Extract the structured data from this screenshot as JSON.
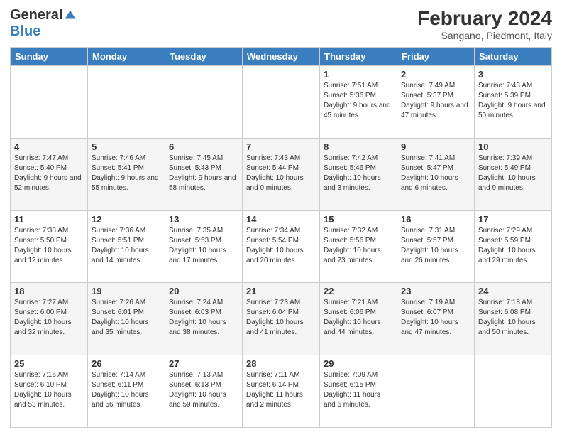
{
  "logo": {
    "general": "General",
    "blue": "Blue"
  },
  "header": {
    "month_year": "February 2024",
    "location": "Sangano, Piedmont, Italy"
  },
  "days_of_week": [
    "Sunday",
    "Monday",
    "Tuesday",
    "Wednesday",
    "Thursday",
    "Friday",
    "Saturday"
  ],
  "weeks": [
    [
      {
        "day": "",
        "info": ""
      },
      {
        "day": "",
        "info": ""
      },
      {
        "day": "",
        "info": ""
      },
      {
        "day": "",
        "info": ""
      },
      {
        "day": "1",
        "info": "Sunrise: 7:51 AM\nSunset: 5:36 PM\nDaylight: 9 hours\nand 45 minutes."
      },
      {
        "day": "2",
        "info": "Sunrise: 7:49 AM\nSunset: 5:37 PM\nDaylight: 9 hours\nand 47 minutes."
      },
      {
        "day": "3",
        "info": "Sunrise: 7:48 AM\nSunset: 5:39 PM\nDaylight: 9 hours\nand 50 minutes."
      }
    ],
    [
      {
        "day": "4",
        "info": "Sunrise: 7:47 AM\nSunset: 5:40 PM\nDaylight: 9 hours\nand 52 minutes."
      },
      {
        "day": "5",
        "info": "Sunrise: 7:46 AM\nSunset: 5:41 PM\nDaylight: 9 hours\nand 55 minutes."
      },
      {
        "day": "6",
        "info": "Sunrise: 7:45 AM\nSunset: 5:43 PM\nDaylight: 9 hours\nand 58 minutes."
      },
      {
        "day": "7",
        "info": "Sunrise: 7:43 AM\nSunset: 5:44 PM\nDaylight: 10 hours\nand 0 minutes."
      },
      {
        "day": "8",
        "info": "Sunrise: 7:42 AM\nSunset: 5:46 PM\nDaylight: 10 hours\nand 3 minutes."
      },
      {
        "day": "9",
        "info": "Sunrise: 7:41 AM\nSunset: 5:47 PM\nDaylight: 10 hours\nand 6 minutes."
      },
      {
        "day": "10",
        "info": "Sunrise: 7:39 AM\nSunset: 5:49 PM\nDaylight: 10 hours\nand 9 minutes."
      }
    ],
    [
      {
        "day": "11",
        "info": "Sunrise: 7:38 AM\nSunset: 5:50 PM\nDaylight: 10 hours\nand 12 minutes."
      },
      {
        "day": "12",
        "info": "Sunrise: 7:36 AM\nSunset: 5:51 PM\nDaylight: 10 hours\nand 14 minutes."
      },
      {
        "day": "13",
        "info": "Sunrise: 7:35 AM\nSunset: 5:53 PM\nDaylight: 10 hours\nand 17 minutes."
      },
      {
        "day": "14",
        "info": "Sunrise: 7:34 AM\nSunset: 5:54 PM\nDaylight: 10 hours\nand 20 minutes."
      },
      {
        "day": "15",
        "info": "Sunrise: 7:32 AM\nSunset: 5:56 PM\nDaylight: 10 hours\nand 23 minutes."
      },
      {
        "day": "16",
        "info": "Sunrise: 7:31 AM\nSunset: 5:57 PM\nDaylight: 10 hours\nand 26 minutes."
      },
      {
        "day": "17",
        "info": "Sunrise: 7:29 AM\nSunset: 5:59 PM\nDaylight: 10 hours\nand 29 minutes."
      }
    ],
    [
      {
        "day": "18",
        "info": "Sunrise: 7:27 AM\nSunset: 6:00 PM\nDaylight: 10 hours\nand 32 minutes."
      },
      {
        "day": "19",
        "info": "Sunrise: 7:26 AM\nSunset: 6:01 PM\nDaylight: 10 hours\nand 35 minutes."
      },
      {
        "day": "20",
        "info": "Sunrise: 7:24 AM\nSunset: 6:03 PM\nDaylight: 10 hours\nand 38 minutes."
      },
      {
        "day": "21",
        "info": "Sunrise: 7:23 AM\nSunset: 6:04 PM\nDaylight: 10 hours\nand 41 minutes."
      },
      {
        "day": "22",
        "info": "Sunrise: 7:21 AM\nSunset: 6:06 PM\nDaylight: 10 hours\nand 44 minutes."
      },
      {
        "day": "23",
        "info": "Sunrise: 7:19 AM\nSunset: 6:07 PM\nDaylight: 10 hours\nand 47 minutes."
      },
      {
        "day": "24",
        "info": "Sunrise: 7:18 AM\nSunset: 6:08 PM\nDaylight: 10 hours\nand 50 minutes."
      }
    ],
    [
      {
        "day": "25",
        "info": "Sunrise: 7:16 AM\nSunset: 6:10 PM\nDaylight: 10 hours\nand 53 minutes."
      },
      {
        "day": "26",
        "info": "Sunrise: 7:14 AM\nSunset: 6:11 PM\nDaylight: 10 hours\nand 56 minutes."
      },
      {
        "day": "27",
        "info": "Sunrise: 7:13 AM\nSunset: 6:13 PM\nDaylight: 10 hours\nand 59 minutes."
      },
      {
        "day": "28",
        "info": "Sunrise: 7:11 AM\nSunset: 6:14 PM\nDaylight: 11 hours\nand 2 minutes."
      },
      {
        "day": "29",
        "info": "Sunrise: 7:09 AM\nSunset: 6:15 PM\nDaylight: 11 hours\nand 6 minutes."
      },
      {
        "day": "",
        "info": ""
      },
      {
        "day": "",
        "info": ""
      }
    ]
  ]
}
